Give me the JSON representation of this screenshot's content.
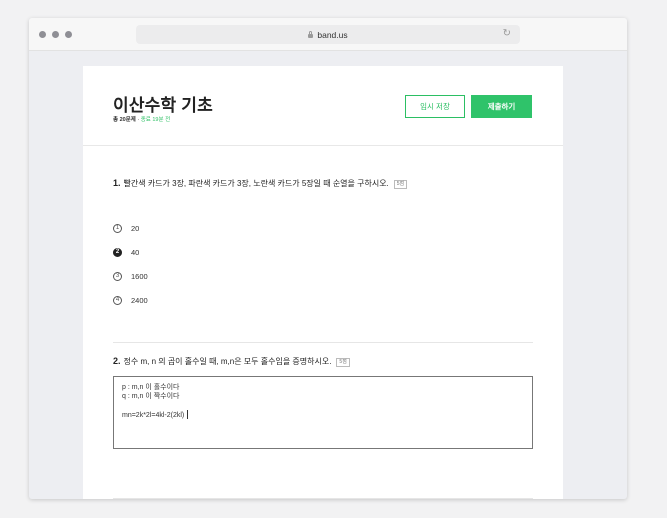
{
  "browser": {
    "url": "band.us"
  },
  "quiz": {
    "title": "이산수학 기초",
    "count_text": "총 20문제",
    "separator": " · ",
    "remaining_text": "종료 19분 전",
    "save_label": "임시 저장",
    "submit_label": "제출하기"
  },
  "questions": [
    {
      "number": "1.",
      "text": "빨간색 카드가 3장, 파란색 카드가 3장, 노란색 카드가 5장일 때 순열을 구하시오.",
      "points": "5점",
      "options": [
        {
          "marker": "1",
          "value": "20",
          "selected": false
        },
        {
          "marker": "2",
          "value": "40",
          "selected": true
        },
        {
          "marker": "3",
          "value": "1600",
          "selected": false
        },
        {
          "marker": "4",
          "value": "2400",
          "selected": false
        }
      ]
    },
    {
      "number": "2.",
      "text": "정수 m, n 의 곱이 홀수일 때, m,n은 모두 홀수임을 증명하시오.",
      "points": "5점",
      "answer_lines": [
        "p : m,n 이 홀수이다",
        "q : m,n 이 짝수이다",
        "",
        "mn=2k*2l=4kl-2(2kl)"
      ]
    }
  ],
  "colors": {
    "accent": "#2bbf63",
    "page_background": "#edeef2",
    "card_background": "#ffffff"
  }
}
